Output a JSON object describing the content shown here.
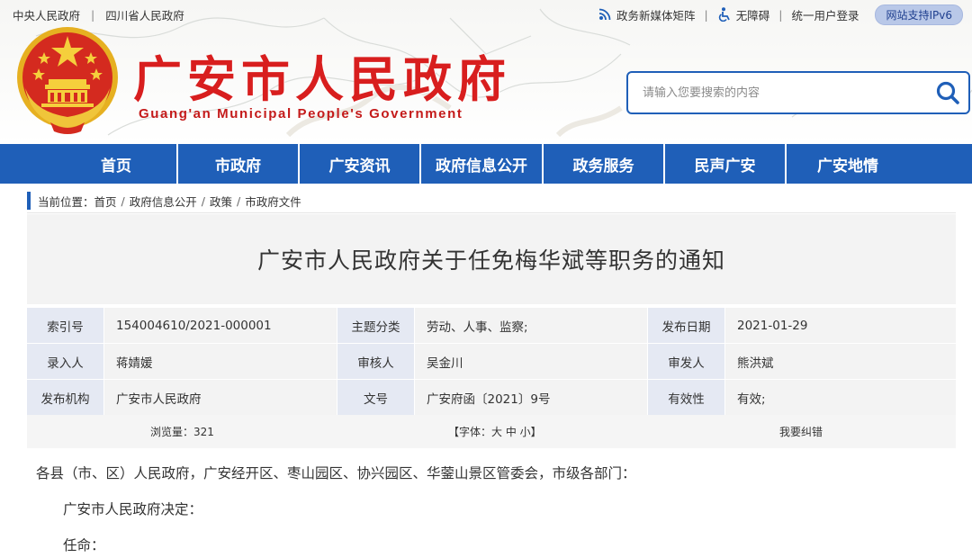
{
  "top_links": [
    "中央人民政府",
    "四川省人民政府"
  ],
  "top_right": {
    "new_media": "政务新媒体矩阵",
    "accessibility": "无障碍",
    "login": "统一用户登录",
    "ipv6": "网站支持IPv6"
  },
  "site": {
    "title_cn": "广安市人民政府",
    "title_en": "Guang'an Municipal People's Government"
  },
  "search": {
    "placeholder": "请输入您要搜索的内容"
  },
  "nav": [
    "首页",
    "市政府",
    "广安资讯",
    "政府信息公开",
    "政务服务",
    "民声广安",
    "广安地情"
  ],
  "breadcrumb": {
    "label": "当前位置：",
    "items": [
      "首页",
      "政府信息公开",
      "政策",
      "市政府文件"
    ]
  },
  "document": {
    "title": "广安市人民政府关于任免梅华斌等职务的通知",
    "info": [
      [
        {
          "label": "索引号",
          "value": "154004610/2021-000001"
        },
        {
          "label": "主题分类",
          "value": "劳动、人事、监察;"
        },
        {
          "label": "发布日期",
          "value": "2021-01-29"
        }
      ],
      [
        {
          "label": "录入人",
          "value": "蒋婧媛"
        },
        {
          "label": "审核人",
          "value": "吴金川"
        },
        {
          "label": "审发人",
          "value": "熊洪斌"
        }
      ],
      [
        {
          "label": "发布机构",
          "value": "广安市人民政府"
        },
        {
          "label": "文号",
          "value": "广安府函〔2021〕9号"
        },
        {
          "label": "有效性",
          "value": "有效;"
        }
      ]
    ],
    "views": "浏览量：321",
    "font_size": "【字体：大 中 小】",
    "report_error": "我要纠错",
    "body": [
      "各县（市、区）人民政府，广安经开区、枣山园区、协兴园区、华蓥山景区管委会，市级各部门：",
      "广安市人民政府决定：",
      "任命："
    ]
  },
  "colors": {
    "brand_red": "#d81e1e",
    "nav_blue": "#1f5fb8",
    "label_bg": "#e5e9f3",
    "value_bg": "#f3f3f3"
  }
}
